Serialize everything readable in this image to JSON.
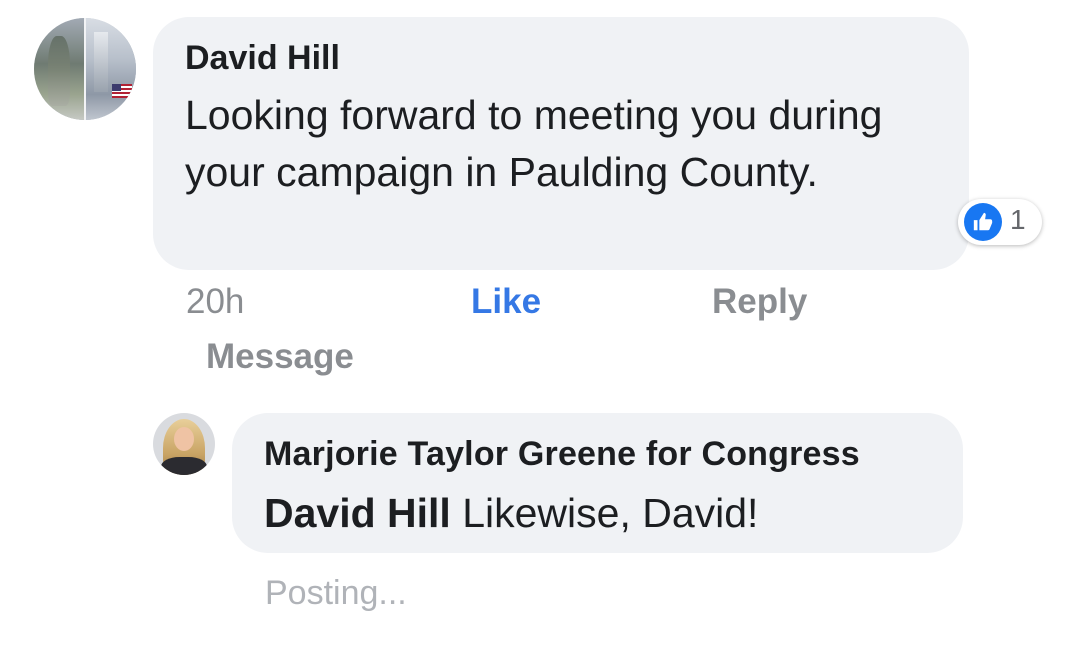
{
  "comment": {
    "author": "David Hill",
    "text": "Looking forward to meeting you during your campaign in Paulding County.",
    "reaction": {
      "icon": "thumbs-up-icon",
      "count": "1",
      "color": "#1877f2"
    },
    "actions": {
      "time": "20h",
      "like": "Like",
      "reply": "Reply",
      "message": "Message"
    }
  },
  "reply": {
    "author": "Marjorie Taylor Greene for Congress",
    "mention": "David Hill",
    "text": " Likewise, David!",
    "status": "Posting..."
  },
  "colors": {
    "bubble": "#f0f2f5",
    "link_active": "#3578e5",
    "muted": "#8a8d91"
  }
}
